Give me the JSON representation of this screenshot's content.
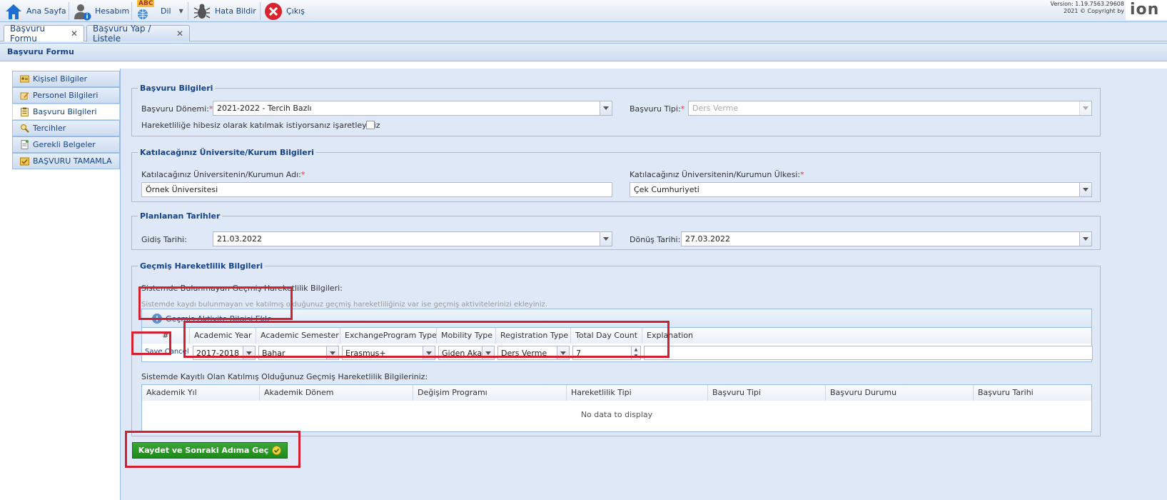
{
  "toolbar": {
    "home": "Ana Sayfa",
    "account": "Hesabım",
    "language": "Dil",
    "language_badge": "ABC",
    "report_bug": "Hata Bildir",
    "logout": "Çıkış",
    "version": "Version: 1.19.7563.29608",
    "copyright": "2021 © Copyright by",
    "brand": "ion"
  },
  "tabs": [
    {
      "label": "Başvuru Formu",
      "close": "✕"
    },
    {
      "label": "Başvuru Yap / Listele",
      "close": "✕"
    }
  ],
  "panel_title": "Başvuru Formu",
  "nav": [
    {
      "label": "Kişisel Bilgiler",
      "icon": "person-card-icon"
    },
    {
      "label": "Personel Bilgileri",
      "icon": "pencil-icon"
    },
    {
      "label": "Başvuru Bilgileri",
      "icon": "clipboard-icon"
    },
    {
      "label": "Tercihler",
      "icon": "magnifier-icon"
    },
    {
      "label": "Gerekli Belgeler",
      "icon": "document-icon"
    },
    {
      "label": "BAŞVURU TAMAMLA",
      "icon": "finish-icon"
    }
  ],
  "basvuru": {
    "legend": "Başvuru Bilgileri",
    "donem_label": "Başvuru Dönemi:",
    "donem_value": "2021-2022 - Tercih Bazlı",
    "tip_label": "Başvuru Tipi:",
    "tip_value": "Ders Verme",
    "hibesiz_label": "Hareketliliğe hibesiz olarak katılmak istiyorsanız işaretleyiniz",
    "req": "*"
  },
  "kurum": {
    "legend": "Katılacağınız Üniversite/Kurum Bilgileri",
    "ad_label": "Katılacağınız Üniversitenin/Kurumun Adı:",
    "ad_value": "Örnek Üniversitesi",
    "ulke_label": "Katılacağınız Üniversitenin/Kurumun Ülkesi:",
    "ulke_value": "Çek Cumhuriyeti"
  },
  "tarihler": {
    "legend": "Planlanan Tarihler",
    "gidis_label": "Gidiş Tarihi:",
    "gidis_value": "21.03.2022",
    "donus_label": "Dönüş Tarihi:",
    "donus_value": "27.03.2022"
  },
  "gecmis": {
    "legend": "Geçmiş Hareketlilik Bilgileri",
    "unregistered_title": "Sistemde Bulunmayan Geçmiş Hareketlilik Bilgileri:",
    "hint": "Sistemde kaydı bulunmayan ve katılmış olduğunuz geçmiş hareketliliğiniz var ise geçmiş aktivitelerinizi ekleyiniz.",
    "add_button": "Geçmiş Aktivite Bilgisi Ekle",
    "columns": [
      "#",
      "Academic Year",
      "Academic Semester",
      "ExchangeProgram Type",
      "Mobility Type",
      "Registration Type",
      "Total Day Count",
      "Explanation"
    ],
    "row": {
      "save": "Save",
      "cancel": "Cancel",
      "year": "2017-2018",
      "semester": "Bahar",
      "program": "Erasmus+",
      "mobility": "Giden Akademik",
      "registration": "Ders Verme",
      "days": "7",
      "explanation": ""
    },
    "registered_title": "Sistemde Kayıtlı Olan Katılmış Olduğunuz Geçmiş Hareketlilik Bilgileriniz:",
    "reg_columns": [
      "Akademik Yıl",
      "Akademik Dönem",
      "Değişim Programı",
      "Hareketlilik Tipi",
      "Başvuru Tipi",
      "Başvuru Durumu",
      "Başvuru Tarihi"
    ],
    "no_data": "No data to display"
  },
  "save_next": "Kaydet ve Sonraki Adıma Geç",
  "colors": {
    "accent": "#15428b",
    "highlight": "#d32030",
    "save": "#1e8a1a"
  }
}
